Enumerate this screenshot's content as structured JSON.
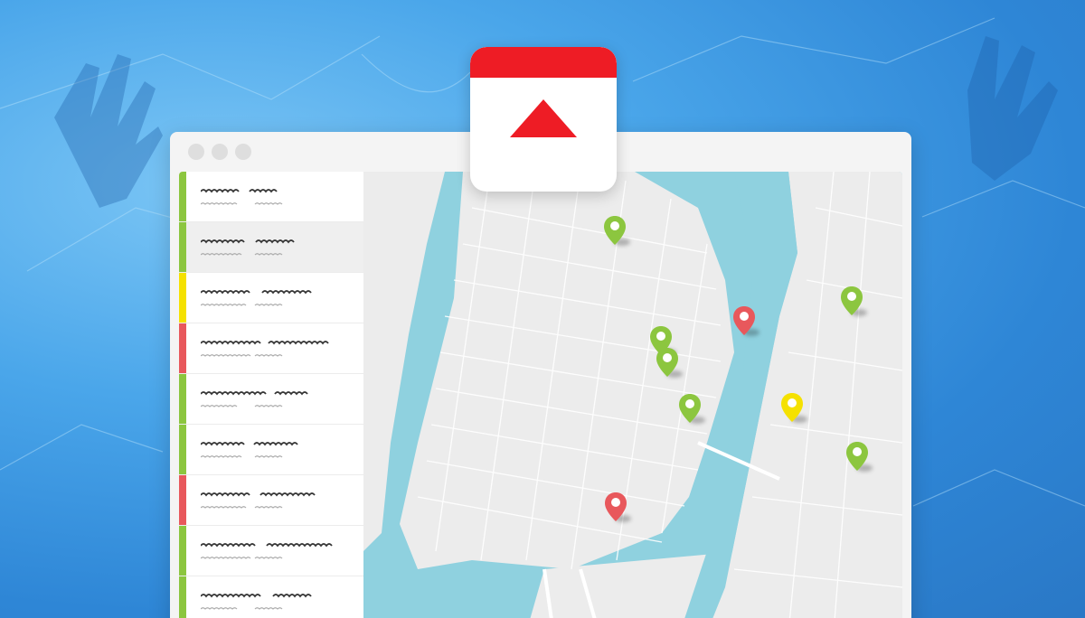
{
  "colors": {
    "green": "#8cc63f",
    "yellow": "#f5e100",
    "red": "#e8585c",
    "brand_red": "#ee1c25",
    "water": "#8fd1df",
    "land": "#ececec"
  },
  "sidebar": {
    "items": [
      {
        "status": "green",
        "selected": false
      },
      {
        "status": "green",
        "selected": true
      },
      {
        "status": "yellow",
        "selected": false
      },
      {
        "status": "red",
        "selected": false
      },
      {
        "status": "green",
        "selected": false
      },
      {
        "status": "green",
        "selected": false
      },
      {
        "status": "red",
        "selected": false
      },
      {
        "status": "green",
        "selected": false
      },
      {
        "status": "green",
        "selected": false
      }
    ]
  },
  "map": {
    "markers": [
      {
        "status": "green"
      },
      {
        "status": "green"
      },
      {
        "status": "red"
      },
      {
        "status": "green"
      },
      {
        "status": "green"
      },
      {
        "status": "green"
      },
      {
        "status": "yellow"
      },
      {
        "status": "green"
      },
      {
        "status": "red"
      }
    ]
  },
  "app_icon": {
    "name": "warning-triangle-icon"
  }
}
